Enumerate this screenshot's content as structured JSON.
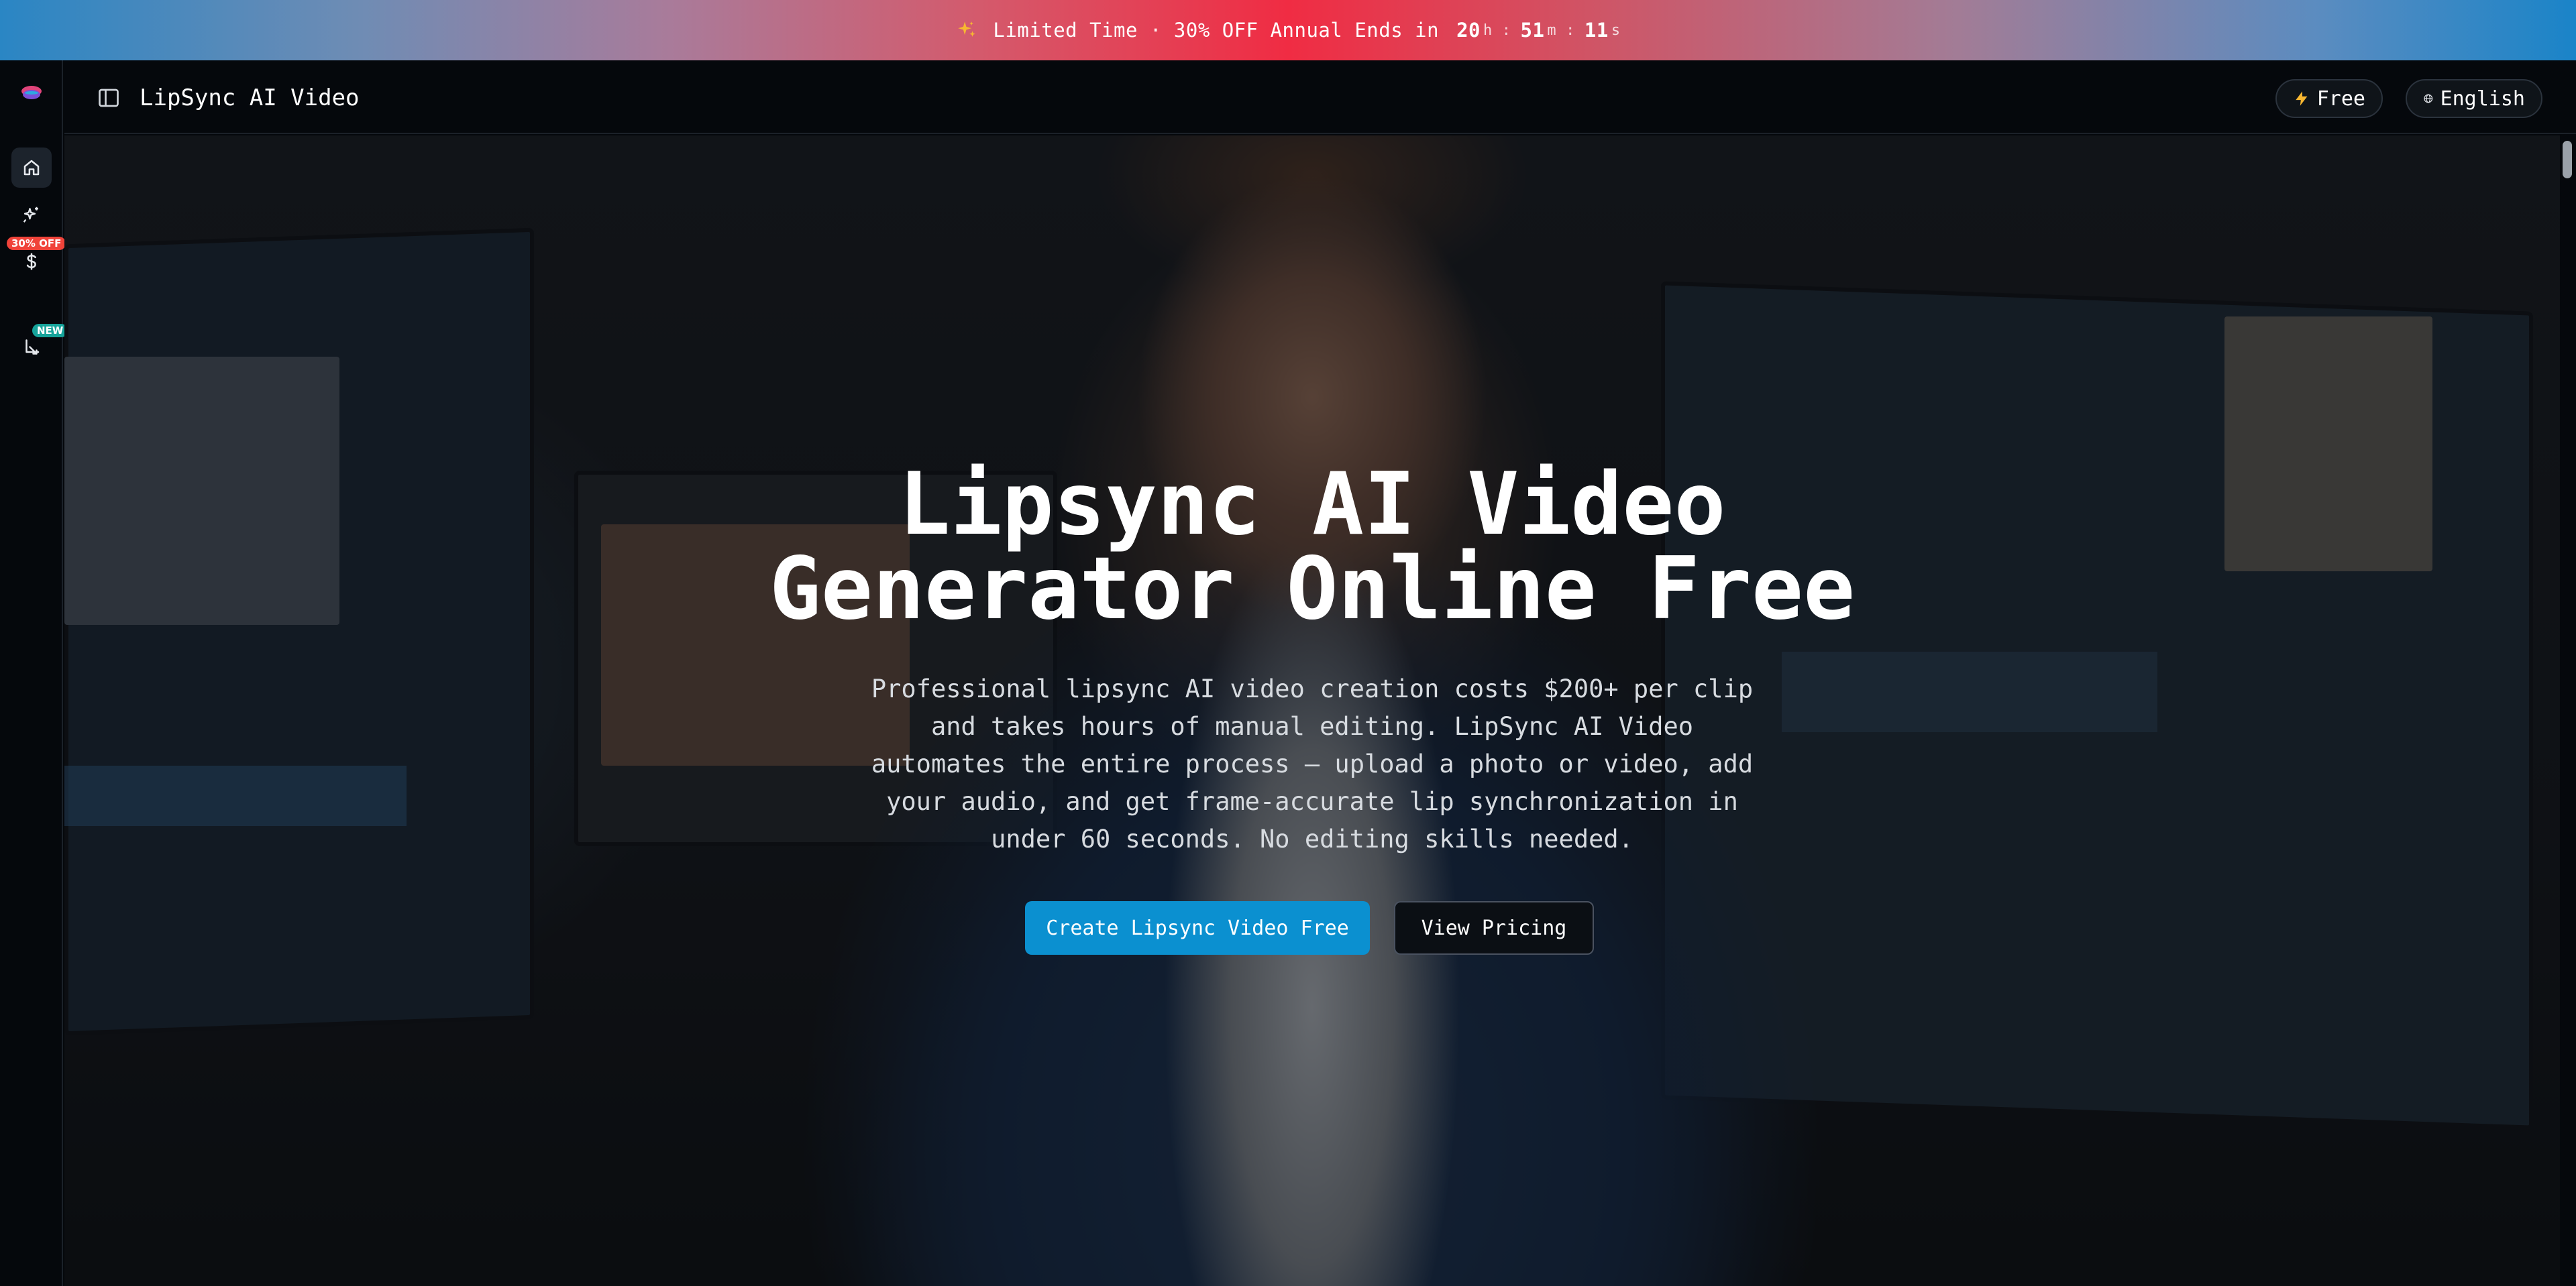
{
  "promo": {
    "icon": "sparkles-icon",
    "label": "Limited Time",
    "separator": "·",
    "offer": "30% OFF Annual",
    "ends_label": "Ends in",
    "hours": "20",
    "hours_unit": "h",
    "minutes": "51",
    "minutes_unit": "m",
    "seconds": "11",
    "seconds_unit": "s",
    "colon": ":",
    "accent_color": "#f02c43"
  },
  "rail": {
    "logo": "lips-logo",
    "items": [
      {
        "icon": "home-icon",
        "active": true
      },
      {
        "icon": "sparkles-icon",
        "active": false
      },
      {
        "icon": "dollar-icon",
        "active": false,
        "badge": "30% OFF"
      },
      {
        "icon": "crop-icon",
        "active": false,
        "badge": "NEW"
      }
    ]
  },
  "header": {
    "title": "LipSync AI Video",
    "toggle_icon": "sidebar-toggle-icon",
    "free_label": "Free",
    "free_icon": "lightning-icon",
    "language_label": "English",
    "language_icon": "globe-icon"
  },
  "hero": {
    "title_line1": "Lipsync AI Video",
    "title_line2": "Generator Online Free",
    "description": "Professional lipsync AI video creation costs $200+ per clip and takes hours of manual editing. LipSync AI Video automates the entire process — upload a photo or video, add your audio, and get frame-accurate lip synchronization in under 60 seconds. No editing skills needed.",
    "primary_cta": "Create Lipsync Video Free",
    "secondary_cta": "View Pricing",
    "primary_color": "#0b90d0"
  }
}
